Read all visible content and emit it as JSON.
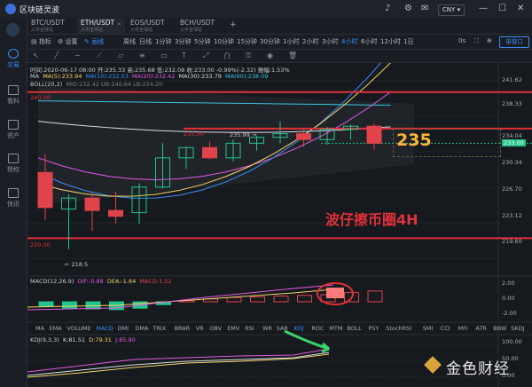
{
  "app": {
    "title": "区块链灵波"
  },
  "header": {
    "currency": "CNY",
    "currency_caret": "▾"
  },
  "sidebar": {
    "items": [
      {
        "label": "交易",
        "icon": "chart-icon",
        "active": true
      },
      {
        "label": "看料",
        "icon": "news-icon",
        "active": false
      },
      {
        "label": "资产",
        "icon": "wallet-icon",
        "active": false
      },
      {
        "label": "授权",
        "icon": "key-icon",
        "active": false
      },
      {
        "label": "快讯",
        "icon": "flash-icon",
        "active": false
      }
    ]
  },
  "tabs": [
    {
      "label": "BTC/USDT",
      "sub": "火币全球站",
      "active": false
    },
    {
      "label": "ETH/USDT",
      "sub": "火币全球站",
      "active": true
    },
    {
      "label": "EOS/USDT",
      "sub": "火币全球站",
      "active": false
    },
    {
      "label": "BCH/USDT",
      "sub": "火币全球站",
      "active": false
    }
  ],
  "toolbar": {
    "indicator": "指标",
    "settings": "设置",
    "drawing": "画线",
    "periods": [
      "周线",
      "日线",
      "1分钟",
      "3分钟",
      "5分钟",
      "10分钟",
      "15分钟",
      "30分钟",
      "1小时",
      "2小时",
      "3小时",
      "4小时",
      "6小时",
      "12小时",
      "1日"
    ],
    "active_period": "4小时",
    "countdown": "0s",
    "window_mode": "单窗口"
  },
  "chart_info": {
    "ohlc": "时间:2020-06-17 08:00  开:235.33  高:235.68  低:232.08  收:233.00  -0.99%(-2.32)  振幅:1.53%",
    "ma_label": "MA",
    "ma5": "MA(5):233.94",
    "ma10": "MA(10):232.53",
    "ma20": "MA(20):232.42",
    "ma30": "MA(30):233.79",
    "ma60": "MA(60):238.09",
    "boll": "BOLL(20,2)",
    "boll_vals": "MID:232.42  UB:240.64  LB:224.20",
    "macd": "MACD(12,26,9)",
    "dif": "DIF:-0.88",
    "dea": "DEA:-1.64",
    "macdv": "MACD:1.52",
    "kdj": "KDJ(9,3,3)",
    "k": "K:81.51",
    "d": "D:79.31",
    "j": "J:85.90"
  },
  "price_axis": [
    "241.62",
    "238.33",
    "234.04",
    "233.00",
    "230.34",
    "226.70",
    "223.12",
    "219.60"
  ],
  "macd_axis": [
    "2.00",
    "0.00",
    "-2.00"
  ],
  "kdj_axis": [
    "100.00",
    "50.00",
    "0.00"
  ],
  "annotations": {
    "big_price": "235",
    "title_text": "波仔擦币圈4H",
    "level_240": "240.00",
    "level_235": "235.00",
    "level_220": "220.00",
    "high_label": "235.99",
    "low_label": "218.5"
  },
  "indicator_tabs": [
    "MA",
    "EMA",
    "VOLUME",
    "MACD",
    "DMI",
    "DMA",
    "TRIX",
    "BRAR",
    "VR",
    "OBV",
    "EMV",
    "RSI",
    "WR",
    "SAR",
    "KDJ",
    "ROC",
    "MTM",
    "BOLL",
    "PSY",
    "StochRSI",
    "SMI",
    "CCI",
    "MFI",
    "ATR",
    "BBW",
    "SKDJ"
  ],
  "watermark": "金色财经",
  "colors": {
    "up": "#23c48a",
    "down": "#e0434b",
    "accent": "#3b8cf6",
    "level_line": "#e0303a",
    "annotation": "#ffb43a"
  },
  "chart_data": {
    "type": "candlestick",
    "candles": [
      {
        "o": 229.0,
        "h": 231.5,
        "l": 222.5,
        "c": 224.2
      },
      {
        "o": 224.0,
        "h": 226.0,
        "l": 218.5,
        "c": 225.5
      },
      {
        "o": 225.5,
        "h": 226.2,
        "l": 221.0,
        "c": 223.8
      },
      {
        "o": 223.8,
        "h": 226.3,
        "l": 222.0,
        "c": 223.0
      },
      {
        "o": 223.5,
        "h": 227.5,
        "l": 222.0,
        "c": 227.0
      },
      {
        "o": 227.0,
        "h": 233.0,
        "l": 226.8,
        "c": 231.0
      },
      {
        "o": 231.0,
        "h": 232.5,
        "l": 229.5,
        "c": 232.4
      },
      {
        "o": 232.4,
        "h": 233.2,
        "l": 230.8,
        "c": 231.0
      },
      {
        "o": 231.0,
        "h": 233.5,
        "l": 230.5,
        "c": 233.0
      },
      {
        "o": 233.0,
        "h": 234.0,
        "l": 232.0,
        "c": 233.8
      },
      {
        "o": 233.8,
        "h": 235.99,
        "l": 233.0,
        "c": 234.3
      },
      {
        "o": 234.3,
        "h": 235.0,
        "l": 232.5,
        "c": 233.5
      },
      {
        "o": 233.5,
        "h": 235.2,
        "l": 232.8,
        "c": 234.9
      },
      {
        "o": 234.9,
        "h": 235.5,
        "l": 233.5,
        "c": 235.33
      },
      {
        "o": 235.33,
        "h": 235.68,
        "l": 232.08,
        "c": 233.0
      }
    ],
    "macd_hist": [
      -0.6,
      -0.9,
      -1.0,
      -1.1,
      -0.9,
      -0.4,
      0.2,
      0.4,
      0.6,
      0.7,
      0.8,
      0.9,
      1.0,
      1.3,
      1.52
    ],
    "ylim": [
      217.5,
      243.0
    ]
  }
}
